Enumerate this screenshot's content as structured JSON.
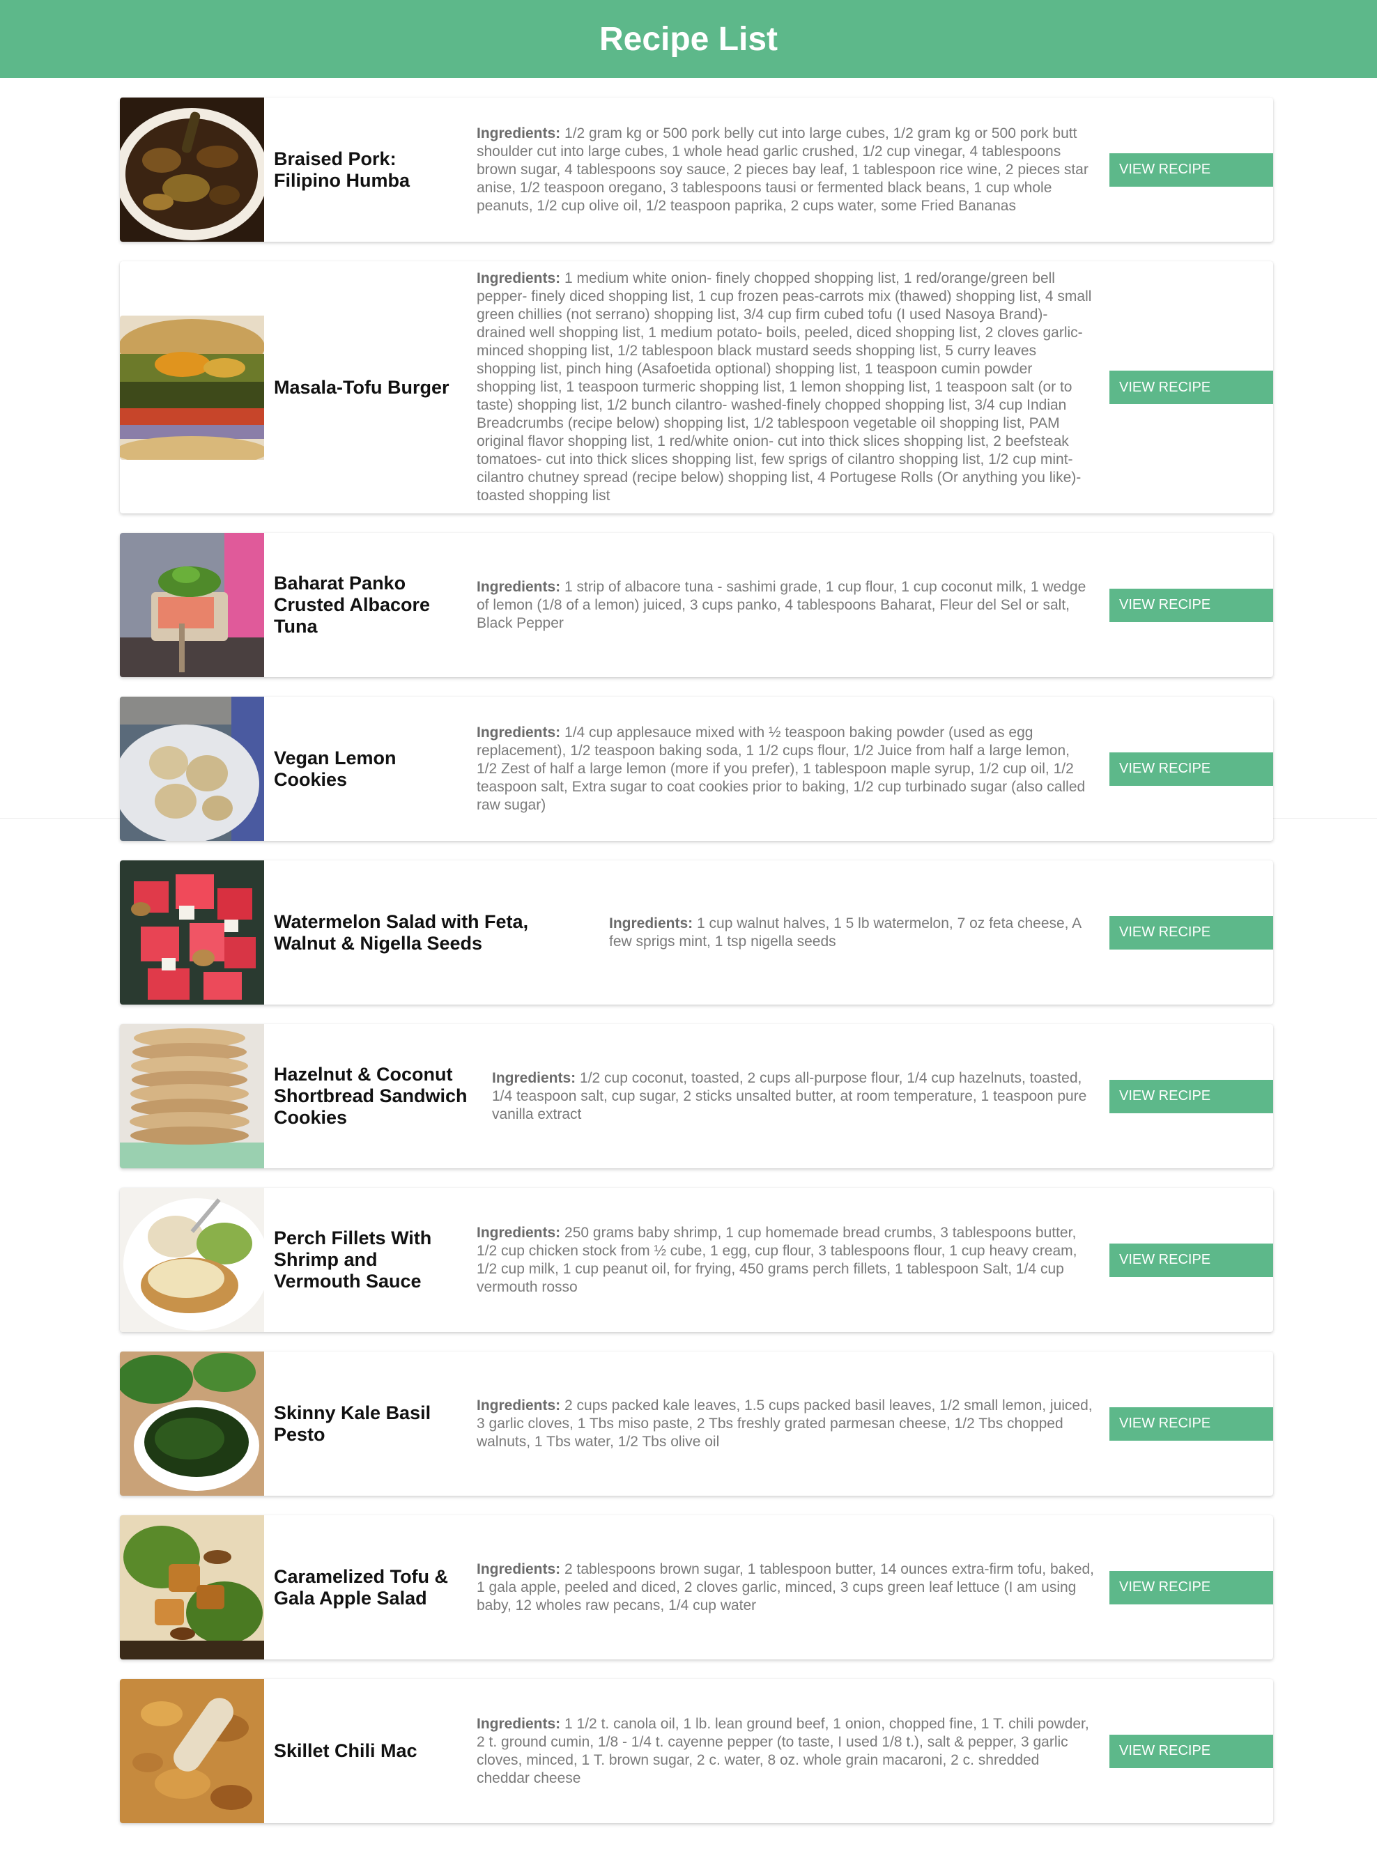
{
  "header": {
    "title": "Recipe List"
  },
  "ingredients_label": "Ingredients:",
  "button_label": "VIEW RECIPE",
  "recipes": [
    {
      "title": "Braised Pork: Filipino Humba",
      "ingredients": "1/2 gram kg or 500 pork belly cut into large cubes, 1/2 gram kg or 500 pork butt shoulder cut into large cubes, 1 whole head garlic crushed, 1/2 cup vinegar, 4 tablespoons brown sugar, 4 tablespoons soy sauce, 2 pieces bay leaf, 1 tablespoon rice wine, 2 pieces star anise, 1/2 teaspoon oregano, 3 tablespoons tausi or fermented black beans, 1 cup whole peanuts, 1/2 cup olive oil, 1/2 teaspoon paprika, 2 cups water, some Fried Bananas"
    },
    {
      "title": "Masala-Tofu Burger",
      "ingredients": "1 medium white onion- finely chopped shopping list, 1 red/orange/green bell pepper- finely diced shopping list, 1 cup frozen peas-carrots mix (thawed) shopping list, 4 small green chillies (not serrano) shopping list, 3/4 cup firm cubed tofu (I used Nasoya Brand)- drained well shopping list, 1 medium potato- boils, peeled, diced shopping list, 2 cloves garlic- minced shopping list, 1/2 tablespoon black mustard seeds shopping list, 5 curry leaves shopping list, pinch hing (Asafoetida optional) shopping list, 1 teaspoon cumin powder shopping list, 1 teaspoon turmeric shopping list, 1 lemon shopping list, 1 teaspoon salt (or to taste) shopping list, 1/2 bunch cilantro- washed-finely chopped shopping list, 3/4 cup Indian Breadcrumbs (recipe below) shopping list, 1/2 tablespoon vegetable oil shopping list, PAM original flavor shopping list, 1 red/white onion- cut into thick slices shopping list, 2 beefsteak tomatoes- cut into thick slices shopping list, few sprigs of cilantro shopping list, 1/2 cup mint-cilantro chutney spread (recipe below) shopping list, 4 Portugese Rolls (Or anything you like)- toasted shopping list"
    },
    {
      "title": "Baharat Panko Crusted Albacore Tuna",
      "ingredients": "1 strip of albacore tuna - sashimi grade, 1 cup flour, 1 cup coconut milk, 1 wedge of lemon (1/8 of a lemon) juiced, 3 cups panko, 4 tablespoons Baharat, Fleur del Sel or salt, Black Pepper"
    },
    {
      "title": "Vegan Lemon Cookies",
      "ingredients": "1/4 cup applesauce mixed with ½ teaspoon baking powder (used as egg replacement), 1/2 teaspoon baking soda, 1 1/2 cups flour, 1/2 Juice from half a large lemon, 1/2 Zest of half a large lemon (more if you prefer), 1 tablespoon maple syrup, 1/2 cup oil, 1/2 teaspoon salt, Extra sugar to coat cookies prior to baking, 1/2 cup turbinado sugar (also called raw sugar)"
    },
    {
      "title": "Watermelon Salad with Feta, Walnut & Nigella Seeds",
      "ingredients": "1 cup walnut halves, 1 5 lb watermelon, 7 oz feta cheese, A few sprigs mint, 1 tsp nigella seeds"
    },
    {
      "title": "Hazelnut & Coconut Shortbread Sandwich Cookies",
      "ingredients": "1/2 cup coconut, toasted, 2 cups all-purpose flour, 1/4 cup hazelnuts, toasted, 1/4 teaspoon salt, cup sugar, 2 sticks unsalted butter, at room temperature, 1 teaspoon pure vanilla extract"
    },
    {
      "title": "Perch Fillets With Shrimp and Vermouth Sauce",
      "ingredients": "250 grams baby shrimp, 1 cup homemade bread crumbs, 3 tablespoons butter, 1/2 cup chicken stock from ½ cube, 1 egg, cup flour, 3 tablespoons flour, 1 cup heavy cream, 1/2 cup milk, 1 cup peanut oil, for frying, 450 grams perch fillets, 1 tablespoon Salt, 1/4 cup vermouth rosso"
    },
    {
      "title": "Skinny Kale Basil Pesto",
      "ingredients": "2 cups packed kale leaves, 1.5 cups packed basil leaves, 1/2 small lemon, juiced, 3 garlic cloves, 1 Tbs miso paste, 2 Tbs freshly grated parmesan cheese, 1/2 Tbs chopped walnuts, 1 Tbs water, 1/2 Tbs olive oil"
    },
    {
      "title": "Caramelized Tofu & Gala Apple Salad",
      "ingredients": "2 tablespoons brown sugar, 1 tablespoon butter, 14 ounces extra-firm tofu, baked, 1 gala apple, peeled and diced, 2 cloves garlic, minced, 3 cups green leaf lettuce (I am using baby, 12 wholes raw pecans, 1/4 cup water"
    },
    {
      "title": "Skillet Chili Mac",
      "ingredients": "1 1/2 t. canola oil, 1 lb. lean ground beef, 1 onion, chopped fine, 1 T. chili powder, 2 t. ground cumin, 1/8 - 1/4 t. cayenne pepper (to taste, I used 1/8 t.), salt & pepper, 3 garlic cloves, minced, 1 T. brown sugar, 2 c. water, 8 oz. whole grain macaroni, 2 c. shredded cheddar cheese"
    }
  ]
}
